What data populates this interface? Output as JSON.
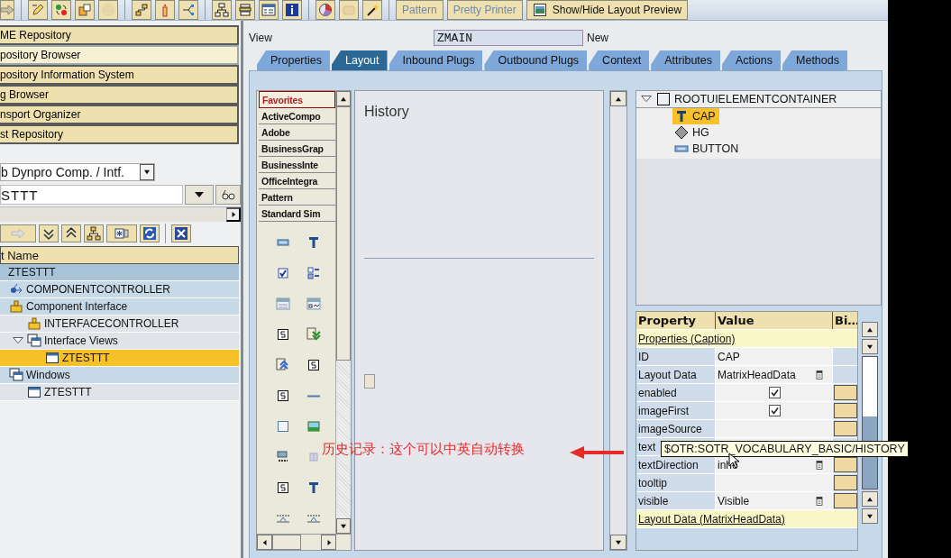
{
  "toolbar": {
    "icon_buttons": [
      {
        "disabled": false
      },
      {
        "disabled": false
      },
      {
        "disabled": false
      },
      {
        "disabled": false
      },
      {
        "disabled": true
      },
      {
        "disabled": false
      },
      {
        "disabled": false
      },
      {
        "disabled": false
      },
      {
        "disabled": false
      },
      {
        "disabled": false
      },
      {
        "disabled": false
      },
      {
        "disabled": false
      },
      {
        "disabled": false
      },
      {
        "disabled": true
      },
      {
        "disabled": false
      }
    ],
    "buttons": [
      {
        "label": "Pattern",
        "disabled": true
      },
      {
        "label": "Pretty Printer",
        "disabled": true
      },
      {
        "label": "Show/Hide Layout Preview",
        "disabled": false
      }
    ]
  },
  "navigation": [
    {
      "label": "ME Repository",
      "selected": false
    },
    {
      "label": "pository Browser",
      "selected": true
    },
    {
      "label": "pository Information System",
      "selected": false
    },
    {
      "label": "g Browser",
      "selected": false
    },
    {
      "label": "nsport Organizer",
      "selected": false
    },
    {
      "label": "st Repository",
      "selected": false
    }
  ],
  "object_type": {
    "value": "b Dynpro Comp. / Intf."
  },
  "object_name": {
    "value": "STTT"
  },
  "object_tree": {
    "header": "t Name",
    "items": [
      {
        "label": "ZTESTTT",
        "selected": false,
        "children": [
          {
            "kind": "controller",
            "label": "COMPONENTCONTROLLER",
            "selected": false
          },
          {
            "kind": "interface",
            "label": "Component Interface",
            "selected": false,
            "children": [
              {
                "kind": "interface",
                "label": "INTERFACECONTROLLER",
                "selected": false
              },
              {
                "kind": "views",
                "label": "Interface Views",
                "selected": false,
                "expanded": true,
                "children": [
                  {
                    "kind": "view",
                    "label": "ZTESTTT",
                    "selected": true
                  }
                ]
              }
            ]
          },
          {
            "kind": "views",
            "label": "Windows",
            "selected": false,
            "children": [
              {
                "kind": "view",
                "label": "ZTESTTT",
                "selected": false
              }
            ]
          }
        ]
      }
    ]
  },
  "view": {
    "label": "View",
    "name": "ZMAIN",
    "status": "New"
  },
  "tabs": [
    {
      "label": "Properties",
      "selected": false
    },
    {
      "label": "Layout",
      "selected": true
    },
    {
      "label": "Inbound Plugs",
      "selected": false
    },
    {
      "label": "Outbound Plugs",
      "selected": false
    },
    {
      "label": "Context",
      "selected": false
    },
    {
      "label": "Attributes",
      "selected": false
    },
    {
      "label": "Actions",
      "selected": false
    },
    {
      "label": "Methods",
      "selected": false
    }
  ],
  "palette": {
    "categories": [
      {
        "label": "Favorites",
        "selected": true
      },
      {
        "label": "ActiveCompo",
        "selected": false
      },
      {
        "label": "Adobe",
        "selected": false
      },
      {
        "label": "BusinessGrap",
        "selected": false
      },
      {
        "label": "BusinessInte",
        "selected": false
      },
      {
        "label": "OfficeIntegra",
        "selected": false
      },
      {
        "label": "Pattern",
        "selected": false
      },
      {
        "label": "Standard Sim",
        "selected": false
      }
    ]
  },
  "preview": {
    "caption": "History"
  },
  "ui_tree": {
    "items": [
      {
        "kind": "container",
        "label": "ROOTUIELEMENTCONTAINER",
        "expanded": true,
        "selected": false,
        "children": [
          {
            "kind": "caption",
            "label": "CAP",
            "selected": true
          },
          {
            "kind": "group",
            "label": "HG",
            "selected": false
          },
          {
            "kind": "button",
            "label": "BUTTON",
            "selected": false
          }
        ]
      }
    ]
  },
  "properties": {
    "columns": [
      "Property",
      "Value",
      "Bi…"
    ],
    "rows": [
      {
        "kind": "group",
        "label": "Properties (Caption)"
      },
      {
        "kind": "text",
        "name": "ID",
        "value": "CAP",
        "bindable": false
      },
      {
        "kind": "dropdown",
        "name": "Layout Data",
        "value": "MatrixHeadData",
        "bindable": false
      },
      {
        "kind": "checkbox",
        "name": "enabled",
        "checked": true,
        "bindable": true
      },
      {
        "kind": "checkbox",
        "name": "imageFirst",
        "checked": true,
        "bindable": true
      },
      {
        "kind": "text",
        "name": "imageSource",
        "bindable": true
      },
      {
        "kind": "text",
        "name": "text"
      },
      {
        "kind": "dropdown",
        "name": "textDirection",
        "value": "inhe",
        "bindable": true
      },
      {
        "kind": "text",
        "name": "tooltip",
        "bindable": true
      },
      {
        "kind": "dropdown",
        "name": "visible",
        "value": "Visible",
        "bindable": true
      },
      {
        "kind": "group",
        "label": "Layout Data (MatrixHeadData)"
      }
    ]
  },
  "tooltip": {
    "text": "$OTR:SOTR_VOCABULARY_BASIC/HISTORY"
  },
  "annotation": {
    "text": "历史记录：这个可以中英自动转换"
  }
}
